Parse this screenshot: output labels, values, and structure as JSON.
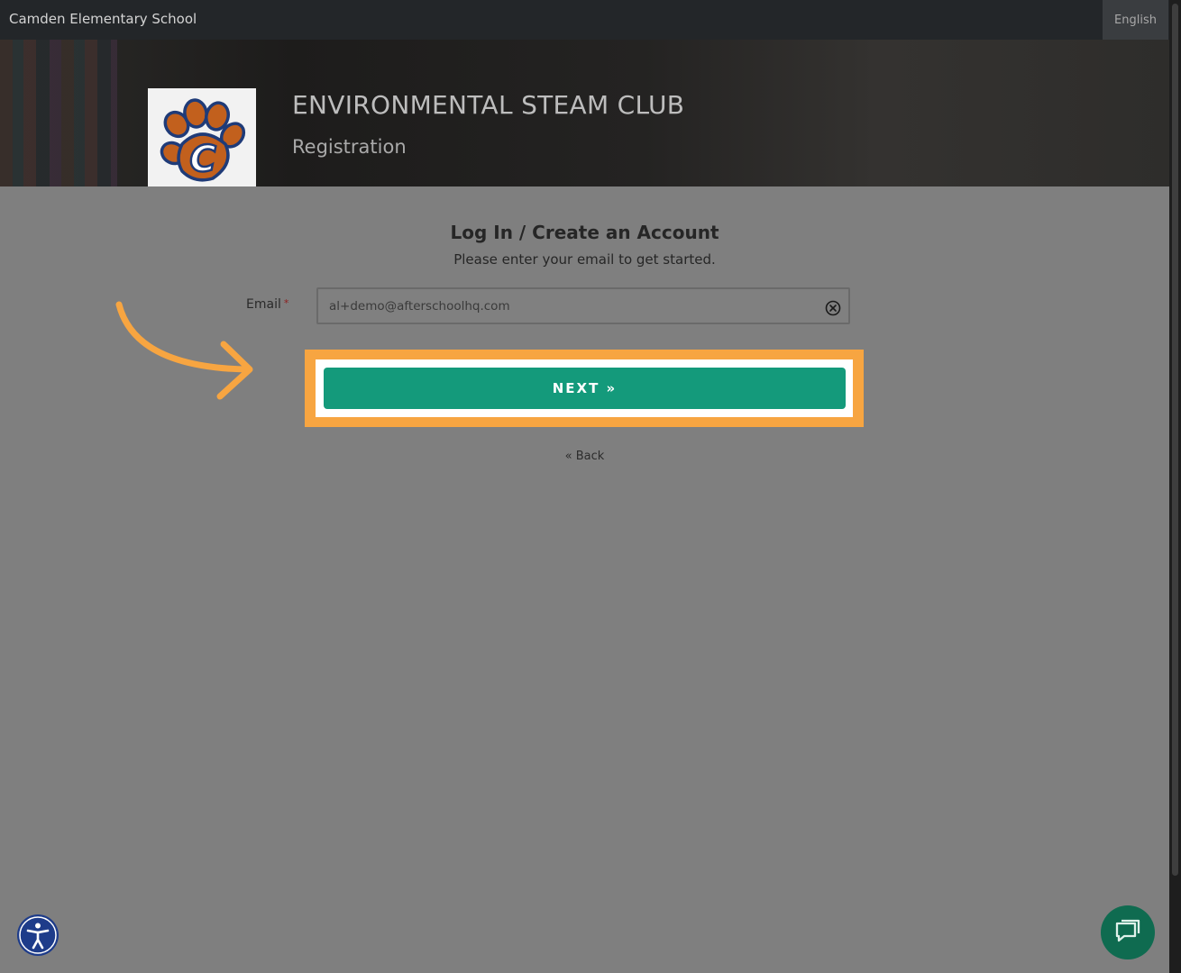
{
  "header": {
    "school_name": "Camden Elementary School",
    "language": "English"
  },
  "hero": {
    "title": "ENVIRONMENTAL STEAM CLUB",
    "subtitle": "Registration",
    "logo_letter": "C"
  },
  "login": {
    "title": "Log In / Create an Account",
    "subtitle": "Please enter your email to get started.",
    "email_label": "Email",
    "required_mark": "*",
    "email_value": "al+demo@afterschoolhq.com",
    "next_label": "NEXT »",
    "back_label": "« Back"
  },
  "colors": {
    "accent_green": "#149a7b",
    "highlight_orange": "#f7a541",
    "chat_green": "#0f6b50",
    "accessibility_blue": "#1e3c8a"
  },
  "icons": {
    "clear": "clear-circle-icon",
    "accessibility": "accessibility-icon",
    "chat": "chat-icon",
    "pointer": "curved-arrow-icon",
    "logo": "paw-logo-icon"
  }
}
